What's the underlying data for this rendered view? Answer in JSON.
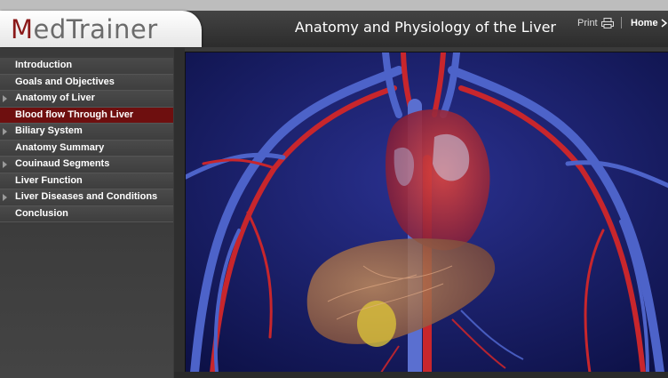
{
  "header": {
    "logo_m": "M",
    "logo_rest": "edTrainer",
    "logo_alt": "MedTrainer",
    "title": "Anatomy and Physiology of the Liver",
    "print_label": "Print",
    "home_label": "Home"
  },
  "sidebar": {
    "items": [
      {
        "label": "Introduction",
        "has_children": false,
        "active": false
      },
      {
        "label": "Goals and Objectives",
        "has_children": false,
        "active": false
      },
      {
        "label": "Anatomy of Liver",
        "has_children": true,
        "active": false
      },
      {
        "label": "Blood flow Through Liver",
        "has_children": false,
        "active": true
      },
      {
        "label": "Biliary System",
        "has_children": true,
        "active": false
      },
      {
        "label": "Anatomy Summary",
        "has_children": false,
        "active": false
      },
      {
        "label": "Couinaud Segments",
        "has_children": true,
        "active": false
      },
      {
        "label": "Liver Function",
        "has_children": false,
        "active": false
      },
      {
        "label": "Liver Diseases and Conditions",
        "has_children": true,
        "active": false
      },
      {
        "label": "Conclusion",
        "has_children": false,
        "active": false
      }
    ]
  },
  "main": {
    "image_subject": "3d-heart-liver-circulatory-illustration"
  },
  "colors": {
    "brand_red": "#8a1818",
    "active_nav": "#6e0f0f",
    "illustration_bg": "#1a1f63"
  }
}
